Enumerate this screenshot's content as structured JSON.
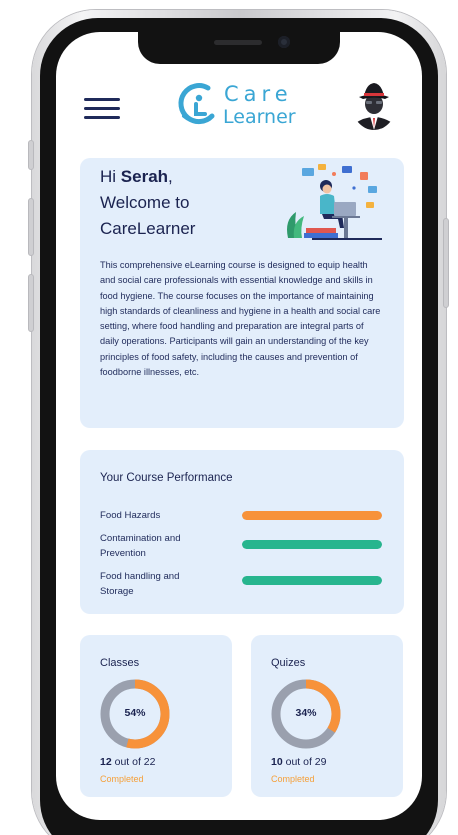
{
  "app": {
    "logo_care": "Care",
    "logo_learner": "Learner"
  },
  "header": {
    "menu_icon": "hamburger-menu-icon",
    "avatar_icon": "spy-avatar-icon"
  },
  "welcome": {
    "greeting": "Hi",
    "user_name": "Serah",
    "comma": ",",
    "line2": "Welcome to",
    "line3": "CareLearner",
    "description": "This comprehensive eLearning course is designed to equip health and social care professionals with essential knowledge and skills in food hygiene. The course focuses on the importance of maintaining high standards of cleanliness and hygiene in a health and social care setting, where food handling and preparation are integral parts of daily operations. Participants will gain an understanding of the key principles of food safety, including the causes and prevention of foodborne illnesses, etc."
  },
  "performance": {
    "title": "Your Course Performance",
    "items": [
      {
        "label": "Food Hazards",
        "fraction": 1.0,
        "color": "#f7923a"
      },
      {
        "label": "Contamination and Prevention",
        "fraction": 1.0,
        "color": "#27b58e"
      },
      {
        "label": "Food handling and Storage",
        "fraction": 1.0,
        "color": "#27b58e"
      }
    ]
  },
  "classes": {
    "title": "Classes",
    "percent_label": "54%",
    "percent": 54,
    "done": "12",
    "total_text": " out of 22",
    "status": "Completed"
  },
  "quizzes": {
    "title": "Quizes",
    "percent_label": "34%",
    "percent": 34,
    "done": "10",
    "total_text": " out of 29",
    "status": "Completed"
  },
  "colors": {
    "accent_orange": "#f7923a",
    "accent_green": "#27b58e",
    "card_bg": "#e3eefb",
    "text_dark": "#1b2350",
    "logo_blue": "#3aa6d4",
    "donut_track": "#9aa0ae"
  }
}
